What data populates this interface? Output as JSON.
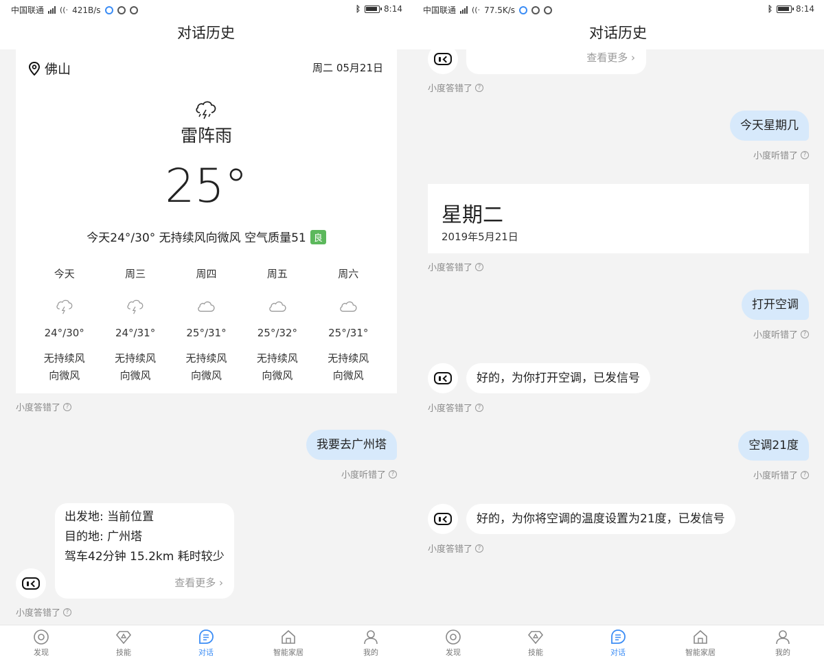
{
  "status_left": {
    "carrier": "中国联通",
    "speed": "421B/s"
  },
  "status_right": {
    "carrier": "中国联通",
    "speed": "77.5K/s"
  },
  "status_time": "8:14",
  "title": "对话历史",
  "feedback": {
    "bot": "小度答错了",
    "user": "小度听错了",
    "help": "?"
  },
  "weather": {
    "city": "佛山",
    "date": "周二 05月21日",
    "condition": "雷阵雨",
    "temp": "25°",
    "summary": "今天24°/30° 无持续风向微风 空气质量51",
    "aq_label": "良",
    "forecast": [
      {
        "day": "今天",
        "icon": "thunderstorm-icon",
        "temp": "24°/30°",
        "wind1": "无持续风",
        "wind2": "向微风"
      },
      {
        "day": "周三",
        "icon": "thunderstorm-icon",
        "temp": "24°/31°",
        "wind1": "无持续风",
        "wind2": "向微风"
      },
      {
        "day": "周四",
        "icon": "cloud-icon",
        "temp": "25°/31°",
        "wind1": "无持续风",
        "wind2": "向微风"
      },
      {
        "day": "周五",
        "icon": "cloud-icon",
        "temp": "25°/32°",
        "wind1": "无持续风",
        "wind2": "向微风"
      },
      {
        "day": "周六",
        "icon": "cloud-icon",
        "temp": "25°/31°",
        "wind1": "无持续风",
        "wind2": "向微风"
      }
    ]
  },
  "left_chat": {
    "user_msg": "我要去广州塔",
    "route": {
      "from": "出发地: 当前位置",
      "to": "目的地: 广州塔",
      "info": "驾车42分钟 15.2km 耗时较少",
      "more": "查看更多 ›"
    }
  },
  "right_chat": {
    "top_more": "查看更多 ›",
    "user1": "今天星期几",
    "day_card": {
      "weekday": "星期二",
      "date": "2019年5月21日"
    },
    "user2": "打开空调",
    "bot2": "好的，为你打开空调，已发信号",
    "user3": "空调21度",
    "bot3": "好的，为你将空调的温度设置为21度，已发信号"
  },
  "nav": [
    {
      "label": "发现",
      "icon": "discover-icon"
    },
    {
      "label": "技能",
      "icon": "skills-icon"
    },
    {
      "label": "对话",
      "icon": "chat-icon",
      "active": true
    },
    {
      "label": "智能家居",
      "icon": "smart-home-icon"
    },
    {
      "label": "我的",
      "icon": "profile-icon"
    }
  ]
}
